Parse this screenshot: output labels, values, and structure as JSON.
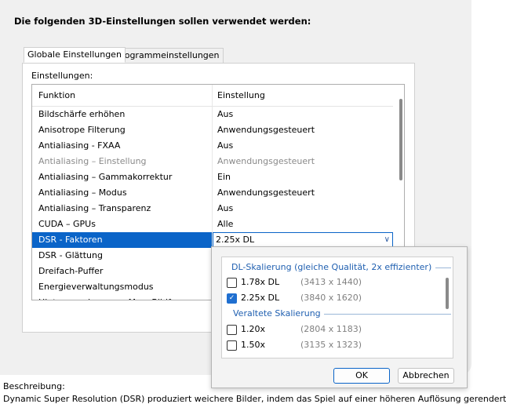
{
  "heading": "Die folgenden 3D-Einstellungen sollen verwendet werden:",
  "tabs": [
    "Globale Einstellungen",
    "Programmeinstellungen"
  ],
  "settings_label": "Einstellungen:",
  "columns": [
    "Funktion",
    "Einstellung"
  ],
  "rows": [
    {
      "f": "Bildschärfe erhöhen",
      "v": "Aus"
    },
    {
      "f": "Anisotrope Filterung",
      "v": "Anwendungsgesteuert"
    },
    {
      "f": "Antialiasing - FXAA",
      "v": "Aus"
    },
    {
      "f": "Antialiasing – Einstellung",
      "v": "Anwendungsgesteuert",
      "disabled": true
    },
    {
      "f": "Antialiasing – Gammakorrektur",
      "v": "Ein"
    },
    {
      "f": "Antialiasing – Modus",
      "v": "Anwendungsgesteuert"
    },
    {
      "f": "Antialiasing – Transparenz",
      "v": "Aus"
    },
    {
      "f": "CUDA – GPUs",
      "v": "Alle"
    },
    {
      "f": "DSR - Faktoren",
      "v": "2.25x DL",
      "selected": true
    },
    {
      "f": "DSR - Glättung",
      "v": ""
    },
    {
      "f": "Dreifach-Puffer",
      "v": ""
    },
    {
      "f": "Energieverwaltungsmodus",
      "v": ""
    },
    {
      "f": "Hintergrund max. ... Max. Bildf...",
      "v": ""
    }
  ],
  "description": {
    "label": "Beschreibung:",
    "text": "Dynamic Super Resolution (DSR) produziert weichere Bilder, indem das Spiel auf einer höheren Auflösung gerendert und"
  },
  "popup": {
    "group1": "DL-Skalierung (gleiche Qualität, 2x effizienter)",
    "group2": "Veraltete Skalierung",
    "options1": [
      {
        "name": "1.78x DL",
        "res": "(3413 x 1440)",
        "checked": false
      },
      {
        "name": "2.25x DL",
        "res": "(3840 x 1620)",
        "checked": true
      }
    ],
    "options2": [
      {
        "name": "1.20x",
        "res": "(2804 x 1183)",
        "checked": false
      },
      {
        "name": "1.50x",
        "res": "(3135 x 1323)",
        "checked": false
      }
    ],
    "ok": "OK",
    "cancel": "Abbrechen"
  },
  "colors": {
    "selection": "#0a64c8",
    "group_title": "#1f5fb0"
  }
}
